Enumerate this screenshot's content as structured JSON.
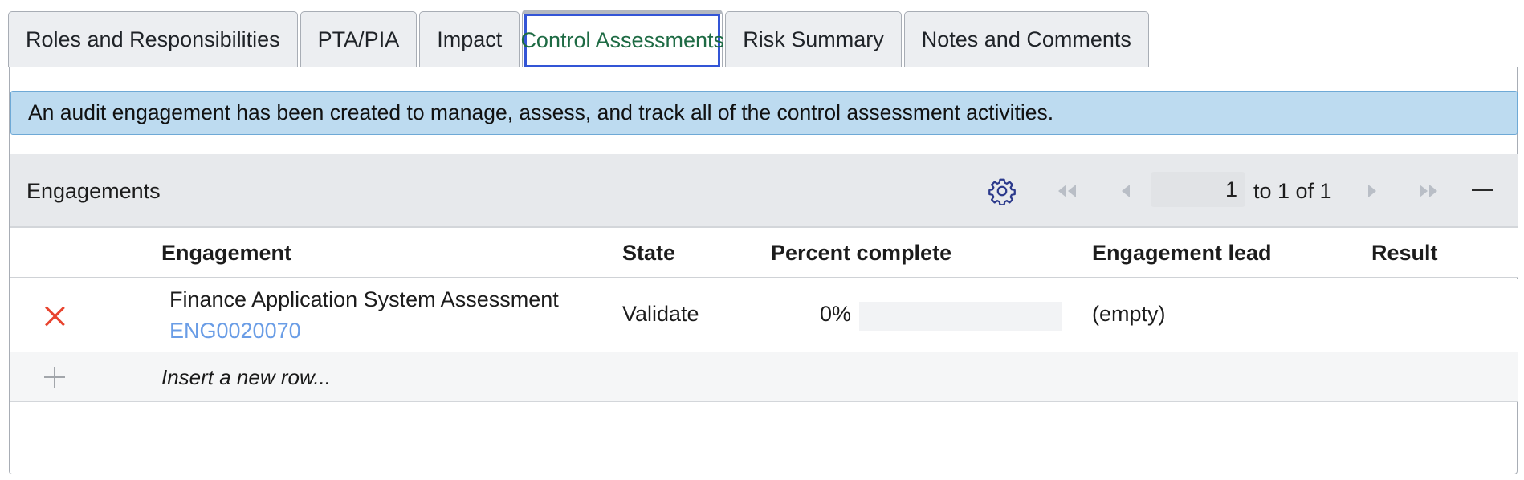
{
  "tabs": [
    {
      "label": "Roles and Responsibilities"
    },
    {
      "label": "PTA/PIA"
    },
    {
      "label": "Impact"
    },
    {
      "label": "Control Assessments",
      "active": true
    },
    {
      "label": "Risk Summary"
    },
    {
      "label": "Notes and Comments"
    }
  ],
  "info_message": "An audit engagement has been created to manage, assess, and track all of the control assessment activities.",
  "related_list": {
    "title": "Engagements",
    "pagination": {
      "current_page": "1",
      "range_text": "to 1 of 1"
    },
    "icons": {
      "settings": "gear-icon",
      "first": "first-page-icon",
      "prev": "previous-page-icon",
      "next": "next-page-icon",
      "last": "last-page-icon",
      "collapse": "collapse-icon"
    },
    "columns": [
      "Engagement",
      "State",
      "Percent complete",
      "Engagement lead",
      "Result"
    ],
    "rows": [
      {
        "engagement": "Finance Application System Assessment",
        "number": "ENG0020070",
        "state": "Validate",
        "percent_complete": "0%",
        "progress_fraction": 0,
        "engagement_lead": "(empty)",
        "result": ""
      }
    ],
    "insert_row_text": "Insert a new row..."
  },
  "colors": {
    "active_tab_text": "#1e6b44",
    "active_tab_focus": "#3355d6",
    "info_bg": "#bddbf0",
    "delete_icon": "#e8432e",
    "link": "#6a9de6"
  }
}
